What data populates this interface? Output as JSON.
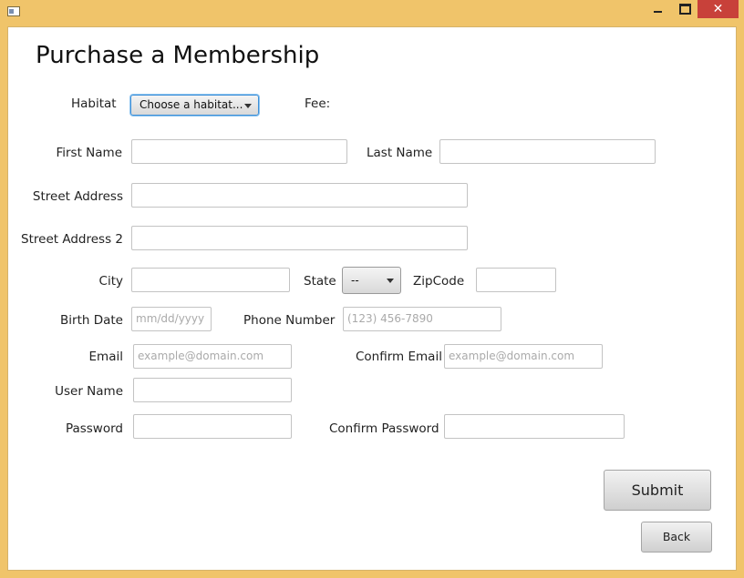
{
  "window": {
    "minimize": "minimize",
    "maximize": "maximize",
    "close": "✕"
  },
  "page_title": "Purchase a Membership",
  "habitat": {
    "label": "Habitat",
    "selected": "Choose a habitat...",
    "fee_label": "Fee:"
  },
  "form": {
    "first_name": {
      "label": "First Name",
      "value": ""
    },
    "last_name": {
      "label": "Last Name",
      "value": ""
    },
    "street1": {
      "label": "Street Address",
      "value": ""
    },
    "street2": {
      "label": "Street Address 2",
      "value": ""
    },
    "city": {
      "label": "City",
      "value": ""
    },
    "state": {
      "label": "State",
      "selected": "--"
    },
    "zip": {
      "label": "ZipCode",
      "value": ""
    },
    "birth_date": {
      "label": "Birth Date",
      "placeholder": "mm/dd/yyyy"
    },
    "phone": {
      "label": "Phone Number",
      "placeholder": "(123) 456-7890"
    },
    "email": {
      "label": "Email",
      "placeholder": "example@domain.com"
    },
    "confirm_email": {
      "label": "Confirm Email",
      "placeholder": "example@domain.com"
    },
    "username": {
      "label": "User Name",
      "value": ""
    },
    "password": {
      "label": "Password",
      "value": ""
    },
    "confirm_password": {
      "label": "Confirm Password",
      "value": ""
    }
  },
  "buttons": {
    "submit": "Submit",
    "back": "Back"
  }
}
